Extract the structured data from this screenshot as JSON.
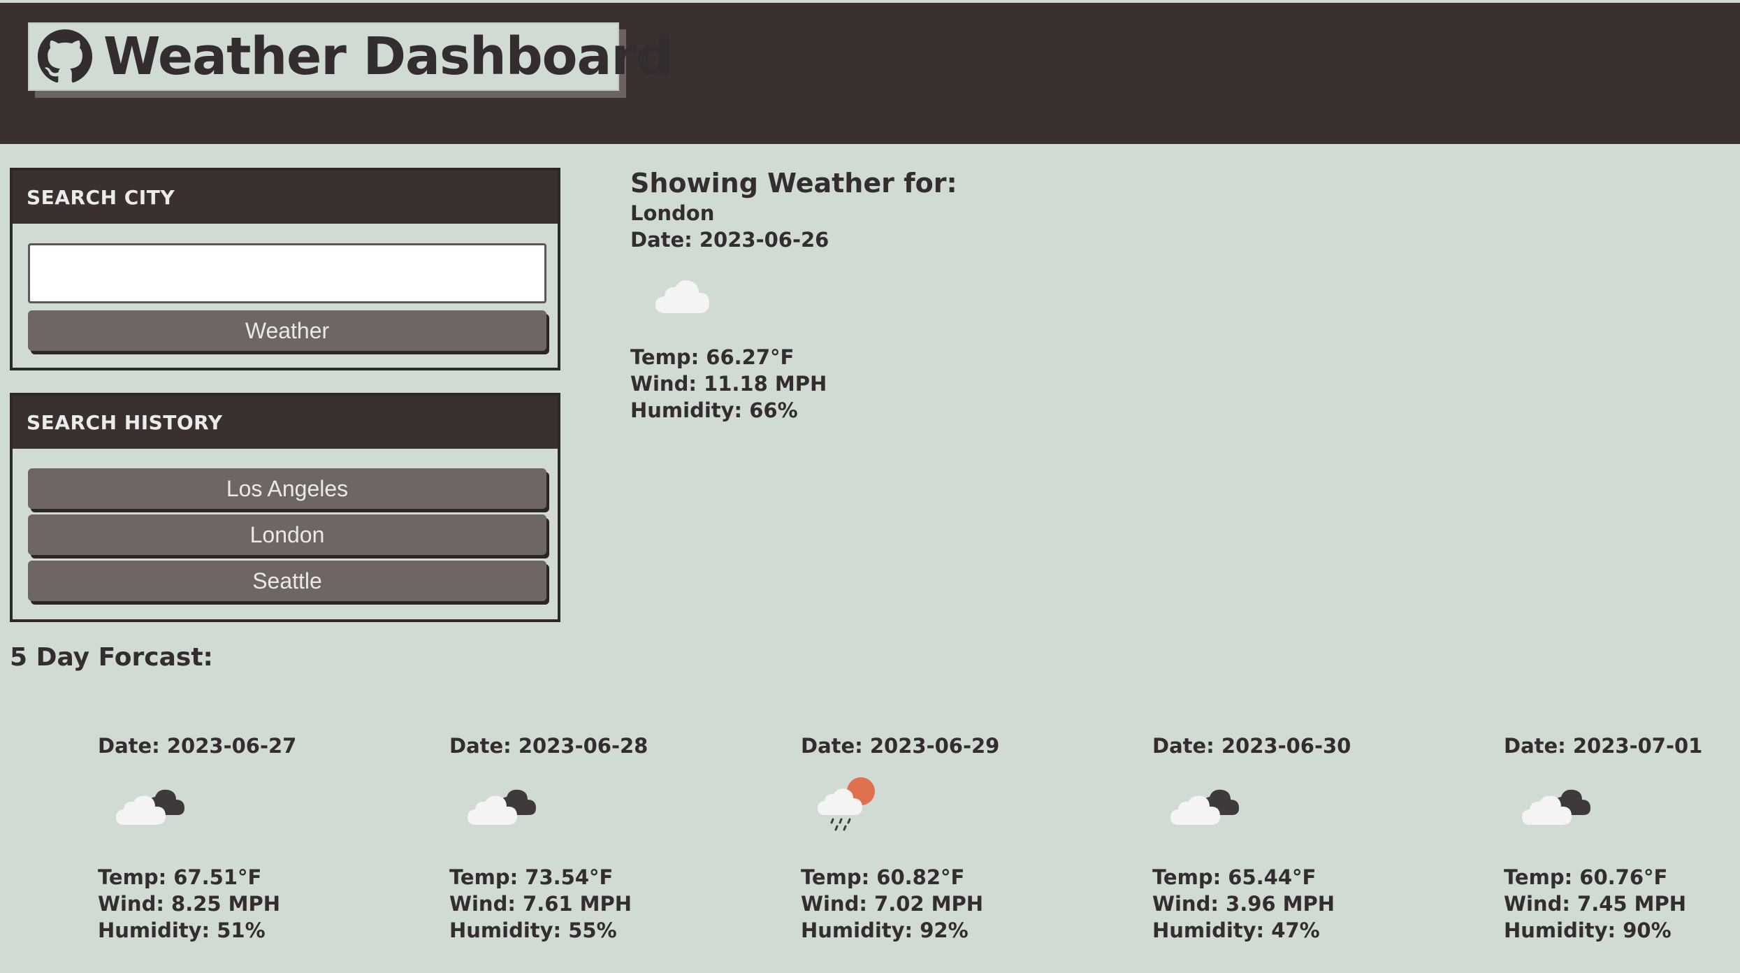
{
  "header": {
    "title": "Weather Dashboard",
    "logo_icon": "github-icon"
  },
  "search": {
    "heading": "SEARCH CITY",
    "input_value": "",
    "button_label": "Weather"
  },
  "history": {
    "heading": "SEARCH HISTORY",
    "items": [
      "Los Angeles",
      "London",
      "Seattle"
    ]
  },
  "current": {
    "heading": "Showing Weather for:",
    "city": "London",
    "date": "Date: 2023-06-26",
    "icon": "cloud-icon",
    "temp": "Temp: 66.27°F",
    "wind": "Wind: 11.18 MPH",
    "humidity": "Humidity: 66%"
  },
  "forecast": {
    "title": "5 Day Forcast:",
    "days": [
      {
        "date": "Date: 2023-06-27",
        "icon": "broken-clouds-icon",
        "temp": "Temp: 67.51°F",
        "wind": "Wind: 8.25 MPH",
        "humidity": "Humidity: 51%"
      },
      {
        "date": "Date: 2023-06-28",
        "icon": "broken-clouds-icon",
        "temp": "Temp: 73.54°F",
        "wind": "Wind: 7.61 MPH",
        "humidity": "Humidity: 55%"
      },
      {
        "date": "Date: 2023-06-29",
        "icon": "rain-sun-icon",
        "temp": "Temp: 60.82°F",
        "wind": "Wind: 7.02 MPH",
        "humidity": "Humidity: 92%"
      },
      {
        "date": "Date: 2023-06-30",
        "icon": "broken-clouds-icon",
        "temp": "Temp: 65.44°F",
        "wind": "Wind: 3.96 MPH",
        "humidity": "Humidity: 47%"
      },
      {
        "date": "Date: 2023-07-01",
        "icon": "broken-clouds-icon",
        "temp": "Temp: 60.76°F",
        "wind": "Wind: 7.45 MPH",
        "humidity": "Humidity: 90%"
      }
    ]
  },
  "colors": {
    "header_bg": "#3a3030",
    "page_bg": "#cfdbd3",
    "button_bg": "#6d6664",
    "sun": "#e0714f"
  }
}
